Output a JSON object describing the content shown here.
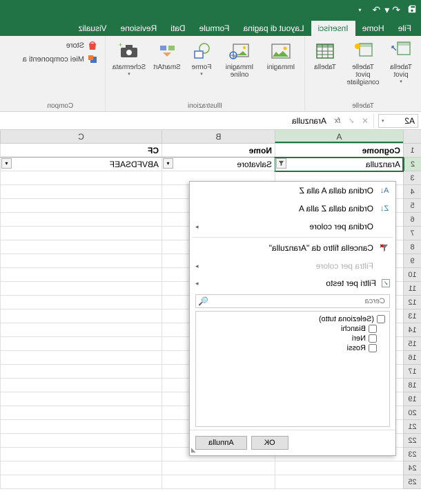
{
  "ribbon_tabs": {
    "file": "File",
    "home": "Home",
    "insert": "Inserisci",
    "layout": "Layout di pagina",
    "formulas": "Formule",
    "data": "Dati",
    "review": "Revisione",
    "view": "Visualiz"
  },
  "ribbon_groups": {
    "tables": {
      "label": "Tabelle",
      "pivot": "Tabella pivot",
      "pivot_rec": "Tabelle pivot consigliate",
      "table": "Tabella"
    },
    "illustrations": {
      "label": "Illustrazioni",
      "images": "Immagini",
      "images_online": "Immagini online",
      "shapes": "Forme",
      "smartart": "SmartArt",
      "screenshot": "Schermata"
    },
    "addins": {
      "label": "Compon",
      "store": "Store",
      "myaddins": "Miei componenti a"
    }
  },
  "namebox": "A2",
  "formula_value": "Aranzulla",
  "columns": [
    "A",
    "B",
    "C"
  ],
  "sheet": {
    "headers": {
      "A": "Cognome",
      "B": "Nome",
      "C": "CF"
    },
    "row2": {
      "A": "Aranzulla",
      "B": "Salvatore",
      "C": "ABVFDSAEF"
    }
  },
  "filter_panel": {
    "sort_az": "Ordina dalla A alla Z",
    "sort_za": "Ordina dalla Z alla A",
    "sort_color": "Ordina per colore",
    "clear_filter": "Cancella filtro da \"Aranzulla\"",
    "filter_color": "Filtra per colore",
    "filter_text": "Filtri per testo",
    "search_placeholder": "Cerca",
    "select_all": "(Seleziona tutto)",
    "items": [
      "Bianchi",
      "Neri",
      "Rossi"
    ],
    "ok": "OK",
    "cancel": "Annulla"
  }
}
